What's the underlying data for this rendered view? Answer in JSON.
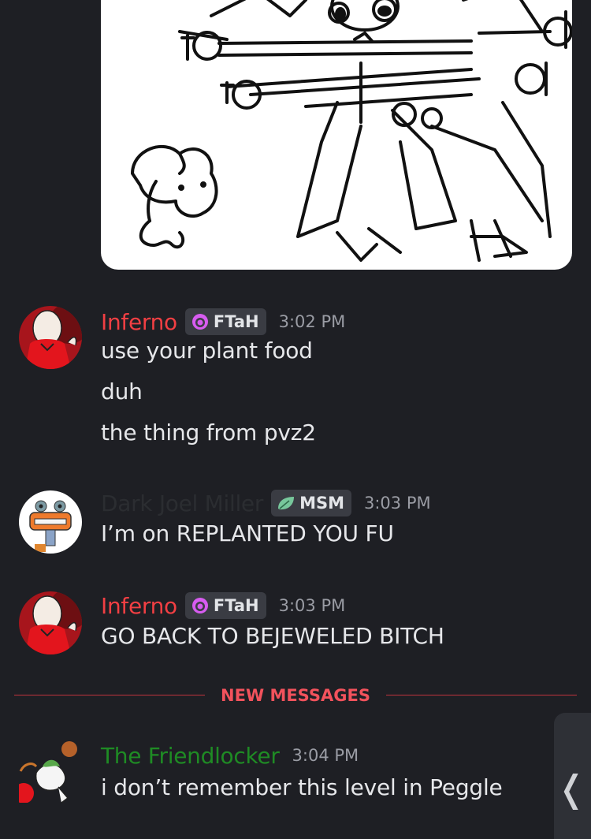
{
  "messages": [
    {
      "username": "Inferno",
      "username_color": "#f23f43",
      "tag": "FTaH",
      "tag_icon": "purple-ghost-icon",
      "timestamp": "3:02 PM",
      "lines": [
        "use your plant food",
        "duh",
        "the thing from pvz2"
      ]
    },
    {
      "username": "Dark Joel Miller",
      "username_color": "#2b2d31",
      "tag": "MSM",
      "tag_icon": "green-leaf-icon",
      "timestamp": "3:03 PM",
      "lines": [
        "I’m on REPLANTED YOU FU"
      ]
    },
    {
      "username": "Inferno",
      "username_color": "#f23f43",
      "tag": "FTaH",
      "tag_icon": "purple-ghost-icon",
      "timestamp": "3:03 PM",
      "lines": [
        "GO BACK TO BEJEWELED BITCH"
      ]
    },
    {
      "username": "The Friendlocker",
      "username_color": "#1f8b24",
      "timestamp": "3:04 PM",
      "lines": [
        "i don’t remember this level in Peggle"
      ]
    }
  ],
  "divider": {
    "label": "NEW MESSAGES",
    "color": "#f2525c"
  },
  "side_tab": {
    "icon": "chevron-left-icon"
  },
  "attachment": {
    "type": "drawing-image"
  }
}
